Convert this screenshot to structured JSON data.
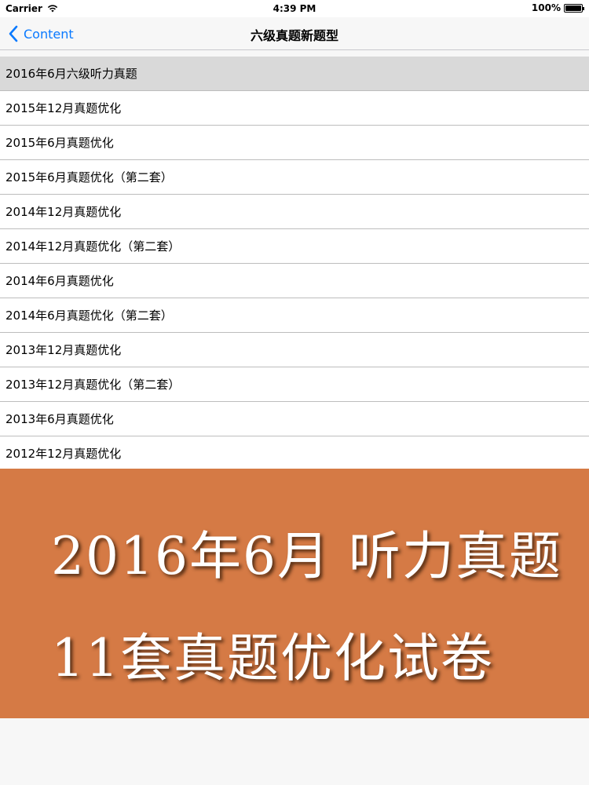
{
  "status_bar": {
    "carrier": "Carrier",
    "time": "4:39 PM",
    "battery": "100%",
    "wifi_icon": "wifi-icon",
    "battery_icon": "battery-icon",
    "battery_level": 1.0
  },
  "nav": {
    "back_label": "Content",
    "title": "六级真题新题型",
    "accent_color": "#0a7aff"
  },
  "list": {
    "selected_index": 0,
    "items": [
      {
        "label": "2016年6月六级听力真题"
      },
      {
        "label": "2015年12月真题优化"
      },
      {
        "label": "2015年6月真题优化"
      },
      {
        "label": "2015年6月真题优化（第二套）"
      },
      {
        "label": "2014年12月真题优化"
      },
      {
        "label": "2014年12月真题优化（第二套）"
      },
      {
        "label": "2014年6月真题优化"
      },
      {
        "label": "2014年6月真题优化（第二套）"
      },
      {
        "label": "2013年12月真题优化"
      },
      {
        "label": "2013年12月真题优化（第二套）"
      },
      {
        "label": "2013年6月真题优化"
      },
      {
        "label": "2012年12月真题优化"
      }
    ]
  },
  "banner": {
    "line1": "2016年6月 听力真题",
    "line2": "11套真题优化试卷",
    "background_color": "#d57a45"
  }
}
